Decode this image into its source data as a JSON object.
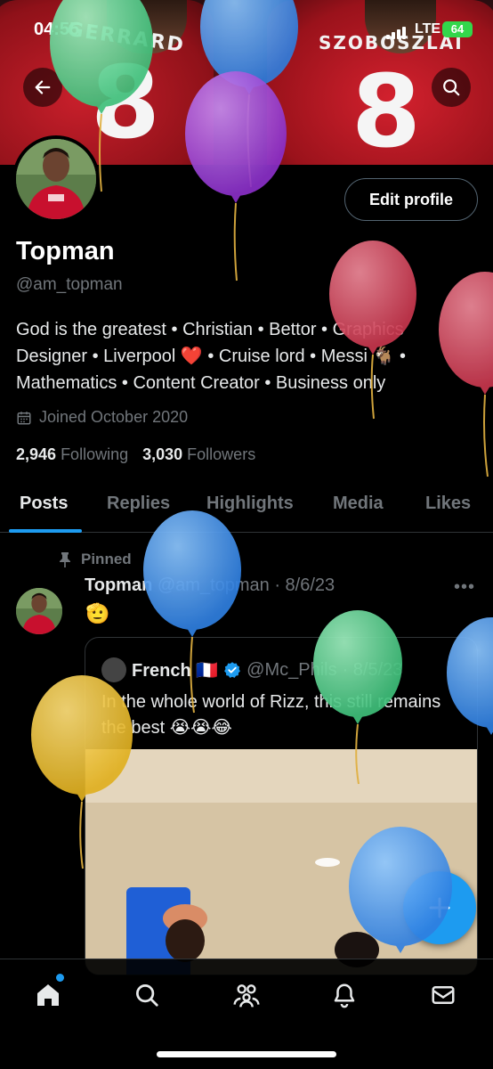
{
  "status_bar": {
    "time": "04:55",
    "network": "LTE",
    "battery": "64"
  },
  "banner": {
    "left_jersey_name": "GERRARD",
    "left_jersey_number": "8",
    "right_jersey_name": "SZOBOSZLAI",
    "right_jersey_number": "8"
  },
  "header": {
    "back_icon": "arrow-left-icon",
    "search_icon": "search-icon"
  },
  "profile": {
    "edit_profile_label": "Edit profile",
    "display_name": "Topman",
    "handle": "@am_topman",
    "bio_line1": "God is the greatest • Christian • Bettor • Graphics",
    "bio_line2": "Designer • Liverpool ❤️ • Cruise lord • Messi 🐐 •",
    "bio_line3": "Mathematics • Content Creator • Business only",
    "joined": "Joined October 2020",
    "following_count": "2,946",
    "following_label": "Following",
    "followers_count": "3,030",
    "followers_label": "Followers"
  },
  "tabs": [
    {
      "label": "Posts",
      "active": true
    },
    {
      "label": "Replies",
      "active": false
    },
    {
      "label": "Highlights",
      "active": false
    },
    {
      "label": "Media",
      "active": false
    },
    {
      "label": "Likes",
      "active": false
    }
  ],
  "pinned_post": {
    "pinned_label": "Pinned",
    "author": "Topman",
    "handle": "@am_topman",
    "date": "· 8/6/23",
    "more": "•••",
    "text": "🫡",
    "quoted": {
      "author": "French 🇫🇷",
      "handle": "@Mc_Phils",
      "date": "· 8/5/23",
      "text": "In the whole world of Rizz, this still remains the best 😭😭😂"
    }
  },
  "fab": {
    "icon": "plus-icon"
  },
  "bottom_nav": [
    {
      "icon": "home-icon",
      "active": true,
      "has_badge": true
    },
    {
      "icon": "search-icon",
      "active": false
    },
    {
      "icon": "communities-icon",
      "active": false
    },
    {
      "icon": "notifications-icon",
      "active": false
    },
    {
      "icon": "messages-icon",
      "active": false
    }
  ],
  "colors": {
    "accent": "#1d9bf0",
    "background": "#000000",
    "muted": "#71767b",
    "text": "#e7e9ea",
    "verified": "#1d9bf0"
  }
}
